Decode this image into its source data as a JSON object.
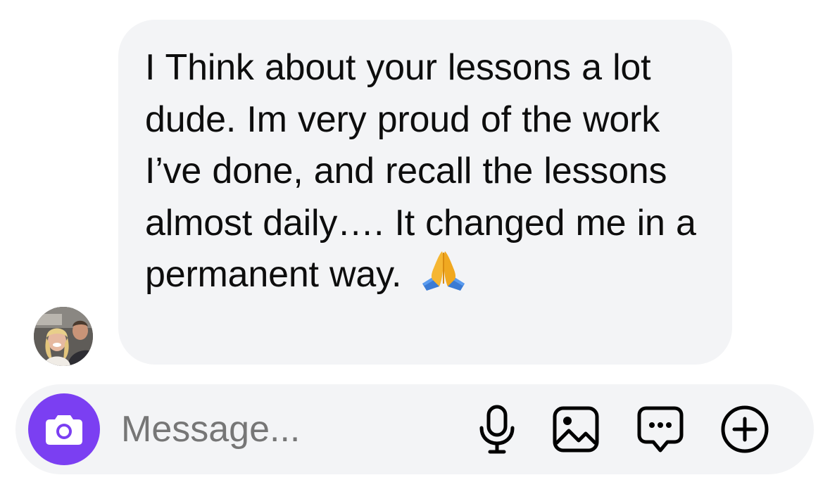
{
  "message": {
    "text": "I Think about your lessons a lot dude.  Im very proud of the work I’ve done, and recall the lessons almost daily….  It changed me in a permanent way.",
    "emoji": "folded-hands"
  },
  "sender": {
    "avatar": "profile-photo"
  },
  "composer": {
    "placeholder": "Message...",
    "camera_color": "#7b3ff2",
    "icons": [
      "camera-icon",
      "microphone-icon",
      "image-icon",
      "chat-bubble-icon",
      "plus-circle-icon"
    ]
  }
}
